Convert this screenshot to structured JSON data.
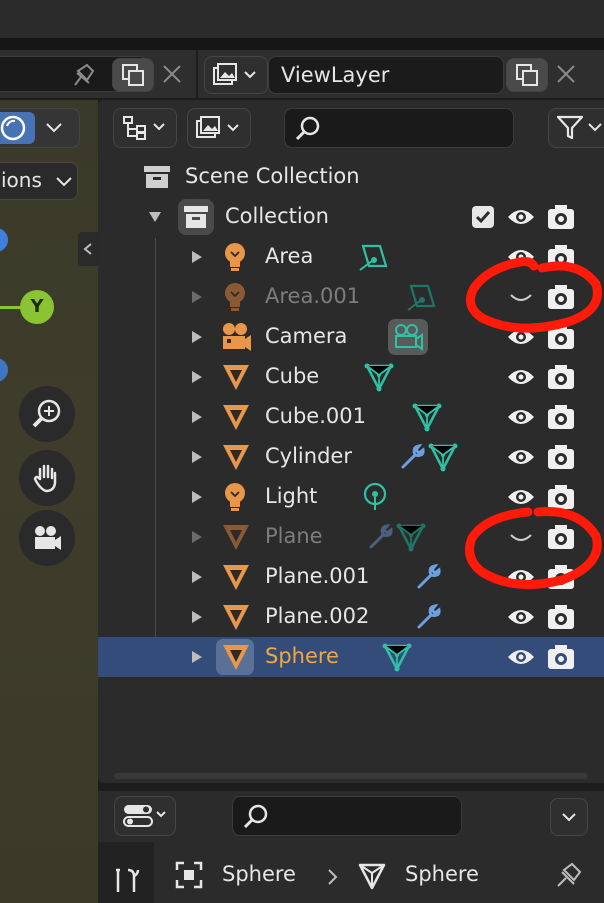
{
  "header_left": {
    "title": "ViewLayer",
    "partial_label": "ions"
  },
  "search": {
    "placeholder": ""
  },
  "outliner": {
    "scene_collection": "Scene Collection",
    "collection": "Collection",
    "items": [
      {
        "name": "Area",
        "icon": "light-icon",
        "data_icon": "area-light-data-icon",
        "dim": false,
        "visible": true,
        "selected": false
      },
      {
        "name": "Area.001",
        "icon": "light-icon",
        "data_icon": "area-light-data-icon",
        "dim": true,
        "visible": false,
        "selected": false
      },
      {
        "name": "Camera",
        "icon": "camera-object-icon",
        "data_icon": "camera-data-icon",
        "dim": false,
        "visible": true,
        "selected": false
      },
      {
        "name": "Cube",
        "icon": "mesh-object-icon",
        "data_icon": "mesh-data-icon",
        "dim": false,
        "visible": true,
        "selected": false
      },
      {
        "name": "Cube.001",
        "icon": "mesh-object-icon",
        "data_icon": "mesh-data-icon",
        "dim": false,
        "visible": true,
        "selected": false
      },
      {
        "name": "Cylinder",
        "icon": "mesh-object-icon",
        "data_icon": "modifier-mesh-icons",
        "dim": false,
        "visible": true,
        "selected": false
      },
      {
        "name": "Light",
        "icon": "light-icon",
        "data_icon": "point-light-data-icon",
        "dim": false,
        "visible": true,
        "selected": false
      },
      {
        "name": "Plane",
        "icon": "mesh-object-icon",
        "data_icon": "modifier-mesh-icons",
        "dim": true,
        "visible": false,
        "selected": false
      },
      {
        "name": "Plane.001",
        "icon": "mesh-object-icon",
        "data_icon": "modifier-icon",
        "dim": false,
        "visible": true,
        "selected": false
      },
      {
        "name": "Plane.002",
        "icon": "mesh-object-icon",
        "data_icon": "modifier-icon",
        "dim": false,
        "visible": true,
        "selected": false
      },
      {
        "name": "Sphere",
        "icon": "mesh-object-icon",
        "data_icon": "mesh-data-icon",
        "dim": false,
        "visible": true,
        "selected": true
      }
    ]
  },
  "properties": {
    "breadcrumb_object": "Sphere",
    "breadcrumb_mesh": "Sphere"
  },
  "viewport": {
    "gizmo_axis": "Y"
  },
  "colors": {
    "accent_selected": "#334c7a",
    "selected_text": "#f2a93b",
    "object_icon": "#e8964a",
    "data_icon_teal": "#2fc1a5",
    "modifier_icon": "#6b9fe0",
    "annotation_red": "#ff1a0a",
    "y_axis": "#8ac432"
  }
}
